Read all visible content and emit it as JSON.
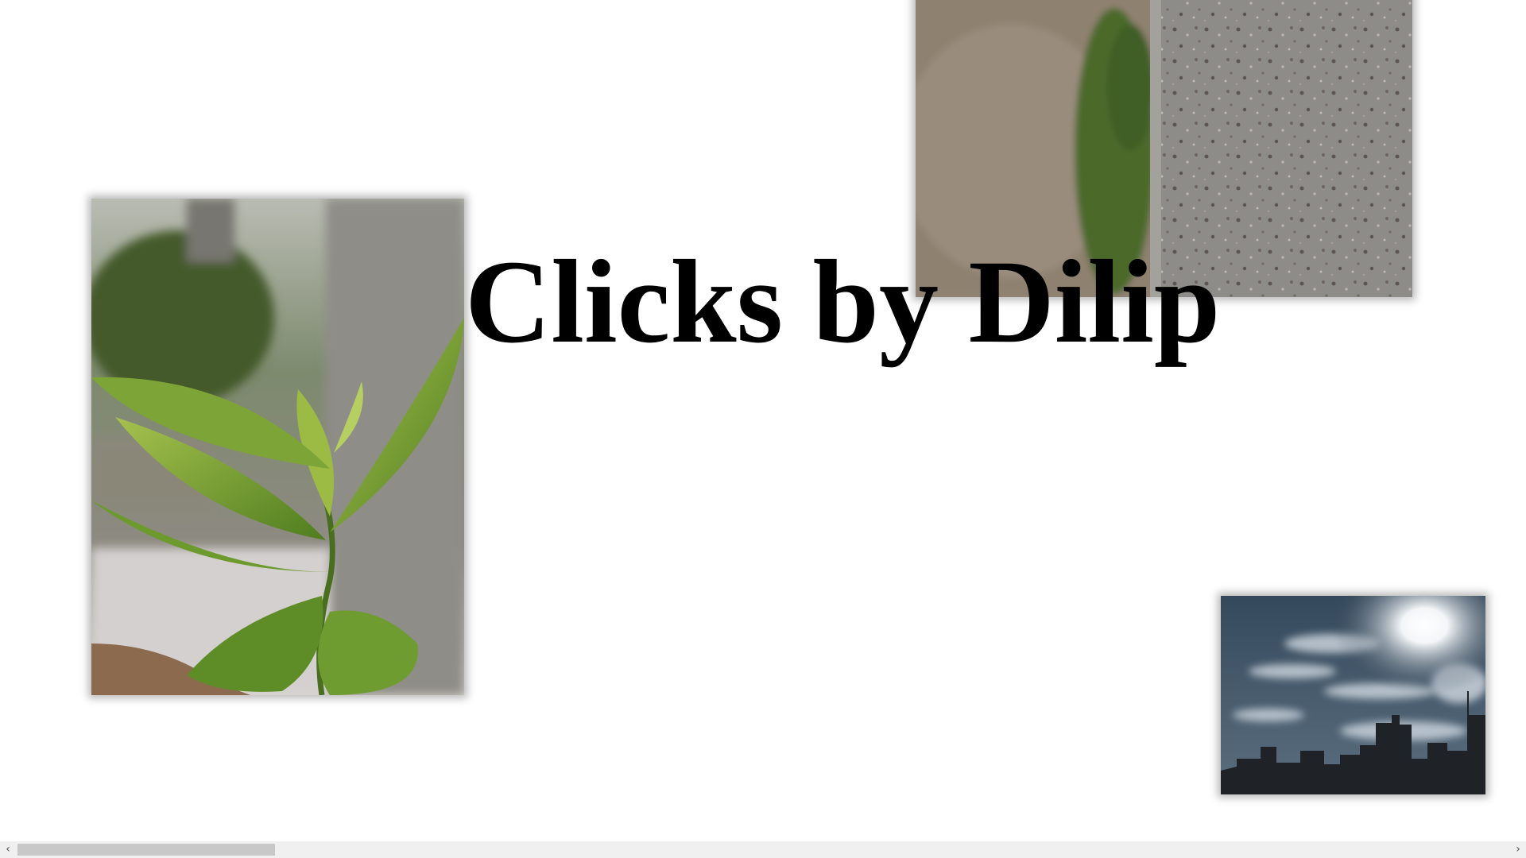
{
  "page": {
    "title": "Clicks by Dilip"
  },
  "photos": [
    {
      "subject": "green plant leaves",
      "icon": "photo-plant"
    },
    {
      "subject": "dirt path beside concrete wall",
      "icon": "photo-ground"
    },
    {
      "subject": "sun in cloudy sky over rooftops",
      "icon": "photo-sky"
    }
  ],
  "scrollbar": {
    "left_arrow": "‹",
    "right_arrow": "›",
    "position": 0
  }
}
